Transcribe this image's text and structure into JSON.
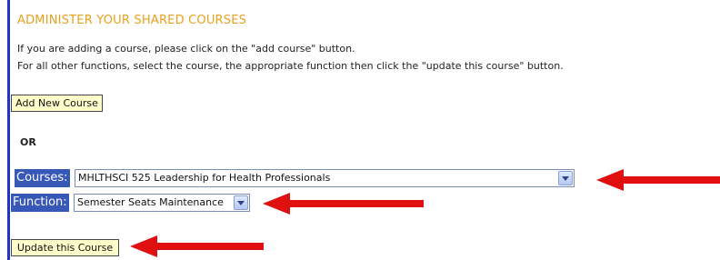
{
  "page": {
    "heading": "ADMINISTER YOUR SHARED COURSES",
    "instructions": [
      "If you are adding a course, please click on the \"add course\" button.",
      "For all other functions, select the course, the appropriate function then click the \"update this course\" button."
    ],
    "add_button_label": "Add New Course",
    "or_text": "OR",
    "courses_label": "Courses:",
    "courses_selected": "MHLTHSCI 525 Leadership for Health Professionals",
    "function_label": "Function:",
    "function_selected": "Semester Seats Maintenance",
    "update_button_label": "Update this Course"
  },
  "colors": {
    "heading": "#e8a020",
    "label_bg": "#3858b8",
    "button_bg": "#ffffcc",
    "arrow": "#e01010",
    "left_rule": "#2233cc"
  },
  "icons": {
    "dropdown": "chevron-down-icon",
    "annotation": "arrow-left-icon"
  }
}
